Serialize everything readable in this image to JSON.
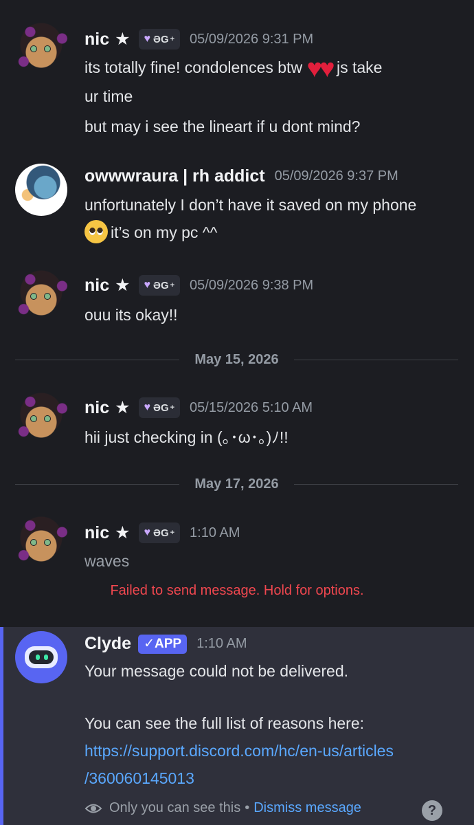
{
  "messages": [
    {
      "author": "nic",
      "star": "★",
      "tag": "ƏG",
      "tag_sup": "+",
      "timestamp": "05/09/2026 9:31 PM",
      "line1a": "its totally fine! condolences btw",
      "line1b": "js take",
      "line2": "ur time",
      "line3": "but may i see the lineart if u dont mind?"
    },
    {
      "author": "owwwraura | rh addict",
      "timestamp": "05/09/2026 9:37 PM",
      "line1": "unfortunately I don’t have it saved on my phone",
      "line2": "it’s on my pc ^^"
    },
    {
      "author": "nic",
      "star": "★",
      "tag": "ƏG",
      "tag_sup": "+",
      "timestamp": "05/09/2026 9:38 PM",
      "line1": "ouu its okay!!"
    },
    {
      "author": "nic",
      "star": "★",
      "tag": "ƏG",
      "tag_sup": "+",
      "timestamp": "05/15/2026 5:10 AM",
      "line1": "hii just checking in  (｡･ω･｡)ﾉ!!"
    },
    {
      "author": "nic",
      "star": "★",
      "tag": "ƏG",
      "tag_sup": "+",
      "timestamp": "1:10 AM",
      "line1": "waves"
    }
  ],
  "dividers": [
    "May 15, 2026",
    "May 17, 2026"
  ],
  "failed_notice": "Failed to send message. Hold for options.",
  "clyde": {
    "author": "Clyde",
    "badge": "✓APP",
    "timestamp": "1:10 AM",
    "line1": "Your message could not be delivered.",
    "line2": "You can see the full list of reasons here:",
    "link1": "https://support.discord.com/hc/en-us/articles",
    "link2": "/360060145013",
    "footer_text": "Only you can see this",
    "footer_sep": "•",
    "dismiss": "Dismiss message",
    "help": "?"
  },
  "icons": [
    "heart-emoji",
    "pleading-face-emoji",
    "eye-icon",
    "help-icon",
    "purple-heart-icon"
  ],
  "colors": {
    "accent": "#5865f2",
    "error": "#f0474f",
    "link": "#5aa8ff",
    "heart": "#e21f3c"
  }
}
